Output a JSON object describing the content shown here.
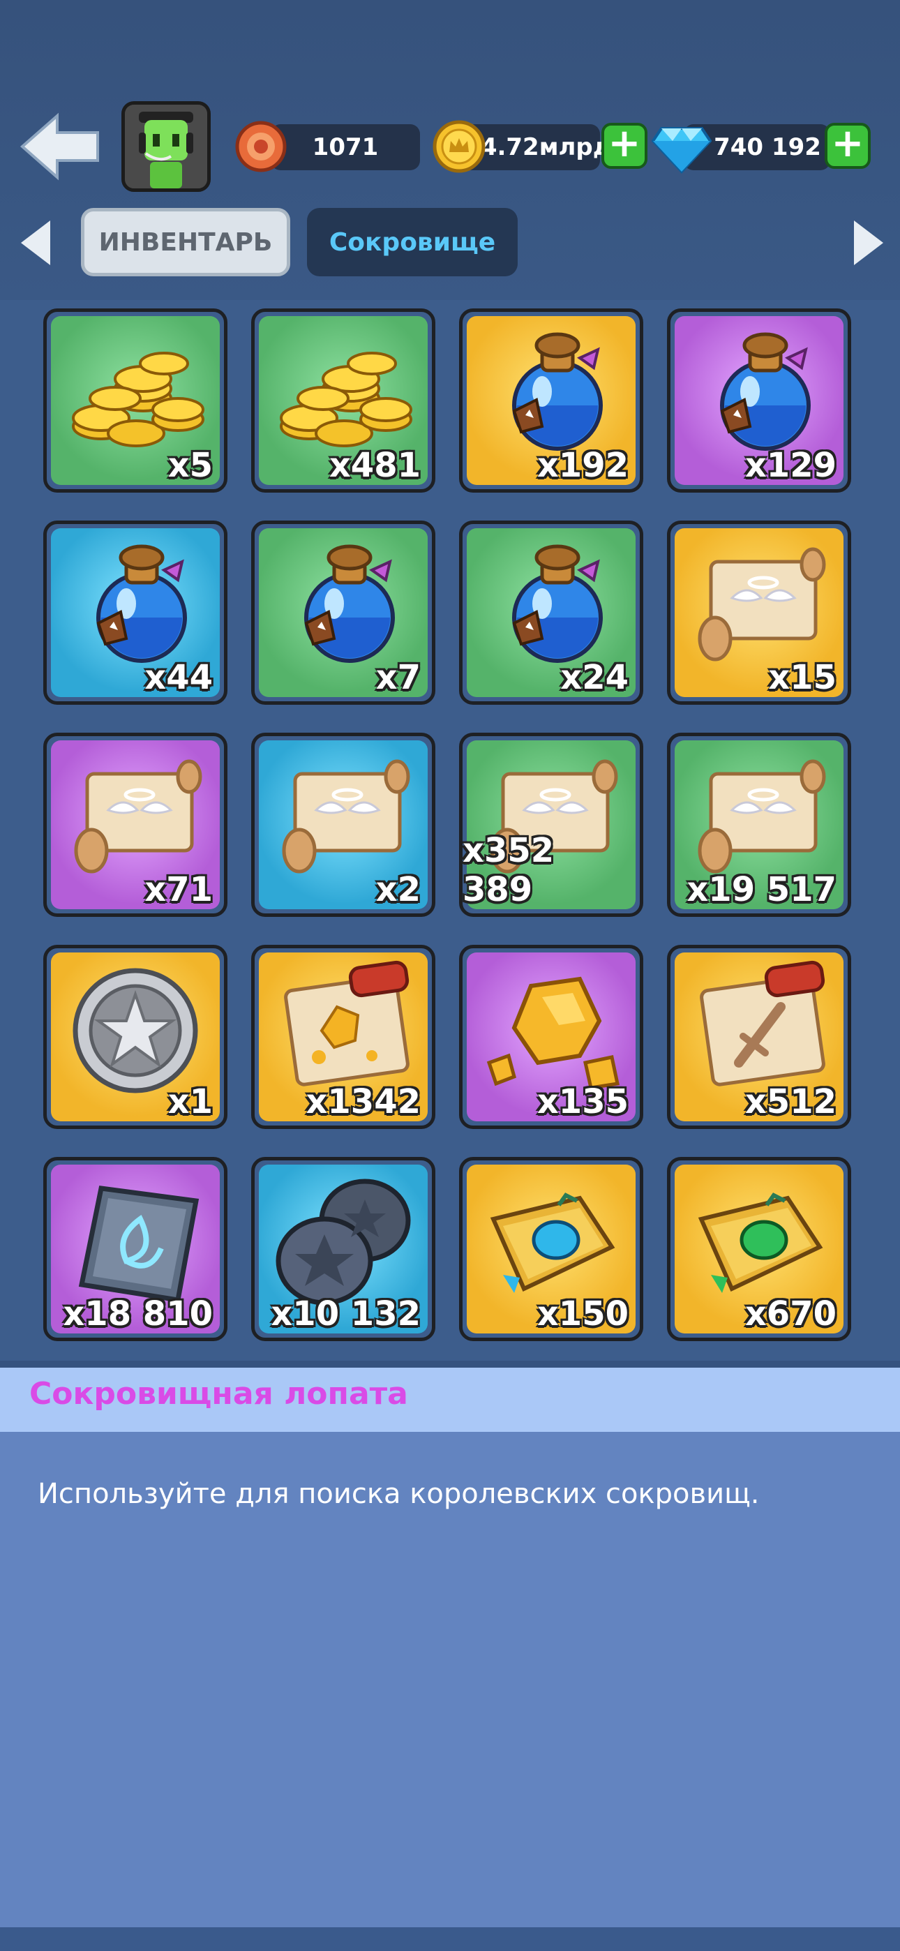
{
  "header": {
    "medals": "1071",
    "gold": "4.72млрд",
    "gems": "740 192"
  },
  "tabs": [
    {
      "label": "ИНВЕНТАРЬ",
      "active": false
    },
    {
      "label": "Сокровище",
      "active": true
    }
  ],
  "items": [
    {
      "icon": "gold-coins-icon",
      "rarity": "green",
      "qty": "x5"
    },
    {
      "icon": "gold-coins-icon",
      "rarity": "green",
      "qty": "x481"
    },
    {
      "icon": "potion-icon",
      "rarity": "gold",
      "qty": "x192"
    },
    {
      "icon": "potion-icon",
      "rarity": "purple",
      "qty": "x129"
    },
    {
      "icon": "potion-icon",
      "rarity": "blue",
      "qty": "x44"
    },
    {
      "icon": "potion-icon",
      "rarity": "green",
      "qty": "x7"
    },
    {
      "icon": "potion-icon",
      "rarity": "green",
      "qty": "x24"
    },
    {
      "icon": "winged-scroll-icon",
      "rarity": "gold",
      "qty": "x15"
    },
    {
      "icon": "winged-scroll-icon",
      "rarity": "purple",
      "qty": "x71"
    },
    {
      "icon": "winged-scroll-icon",
      "rarity": "blue",
      "qty": "x2"
    },
    {
      "icon": "winged-scroll-icon",
      "rarity": "green",
      "qty": "x352 389"
    },
    {
      "icon": "winged-scroll-icon",
      "rarity": "green",
      "qty": "x19 517"
    },
    {
      "icon": "silver-star-coin-icon",
      "rarity": "gold",
      "qty": "x1"
    },
    {
      "icon": "gold-map-scroll-icon",
      "rarity": "gold",
      "qty": "x1342"
    },
    {
      "icon": "gold-ore-icon",
      "rarity": "purple",
      "qty": "x135"
    },
    {
      "icon": "sword-scroll-icon",
      "rarity": "gold",
      "qty": "x512"
    },
    {
      "icon": "rune-stone-icon",
      "rarity": "purple",
      "qty": "x18 810"
    },
    {
      "icon": "star-stones-icon",
      "rarity": "blue",
      "qty": "x10 132"
    },
    {
      "icon": "blue-orb-book-icon",
      "rarity": "gold",
      "qty": "x150"
    },
    {
      "icon": "green-orb-book-icon",
      "rarity": "gold",
      "qty": "x670"
    }
  ],
  "detail": {
    "title": "Сокровищная лопата",
    "description": "Используйте для поиска королевских сокровищ."
  },
  "colors": {
    "background": "#35527f",
    "title_accent": "#d94be6",
    "plus_button": "#3cc23b",
    "tab_active_text": "#5ac8f8"
  }
}
